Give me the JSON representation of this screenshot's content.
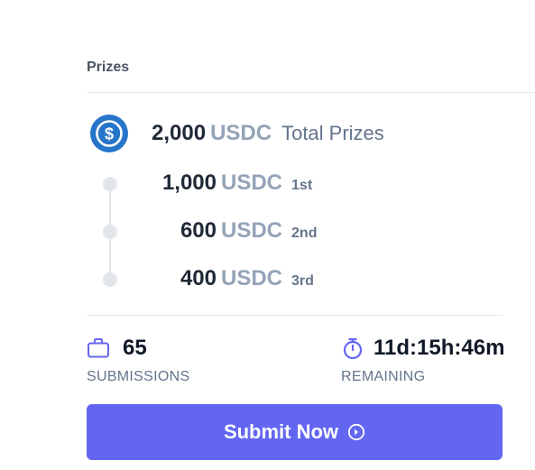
{
  "prizes": {
    "title": "Prizes",
    "total": {
      "amount": "2,000",
      "unit": "USDC",
      "label": "Total Prizes",
      "icon": "usdc-coin-icon"
    },
    "places": [
      {
        "amount": "1,000",
        "unit": "USDC",
        "label": "1st"
      },
      {
        "amount": "600",
        "unit": "USDC",
        "label": "2nd"
      },
      {
        "amount": "400",
        "unit": "USDC",
        "label": "3rd"
      }
    ]
  },
  "stats": {
    "submissions": {
      "value": "65",
      "label": "SUBMISSIONS",
      "icon": "briefcase-icon"
    },
    "remaining": {
      "value": "11d:15h:46m",
      "label": "REMAINING",
      "icon": "stopwatch-icon"
    }
  },
  "submit": {
    "label": "Submit Now",
    "icon": "arrow-circle-right-icon"
  },
  "colors": {
    "accent": "#6366f1",
    "usdc_blue": "#2775ca",
    "muted_unit": "#94a3b8"
  }
}
